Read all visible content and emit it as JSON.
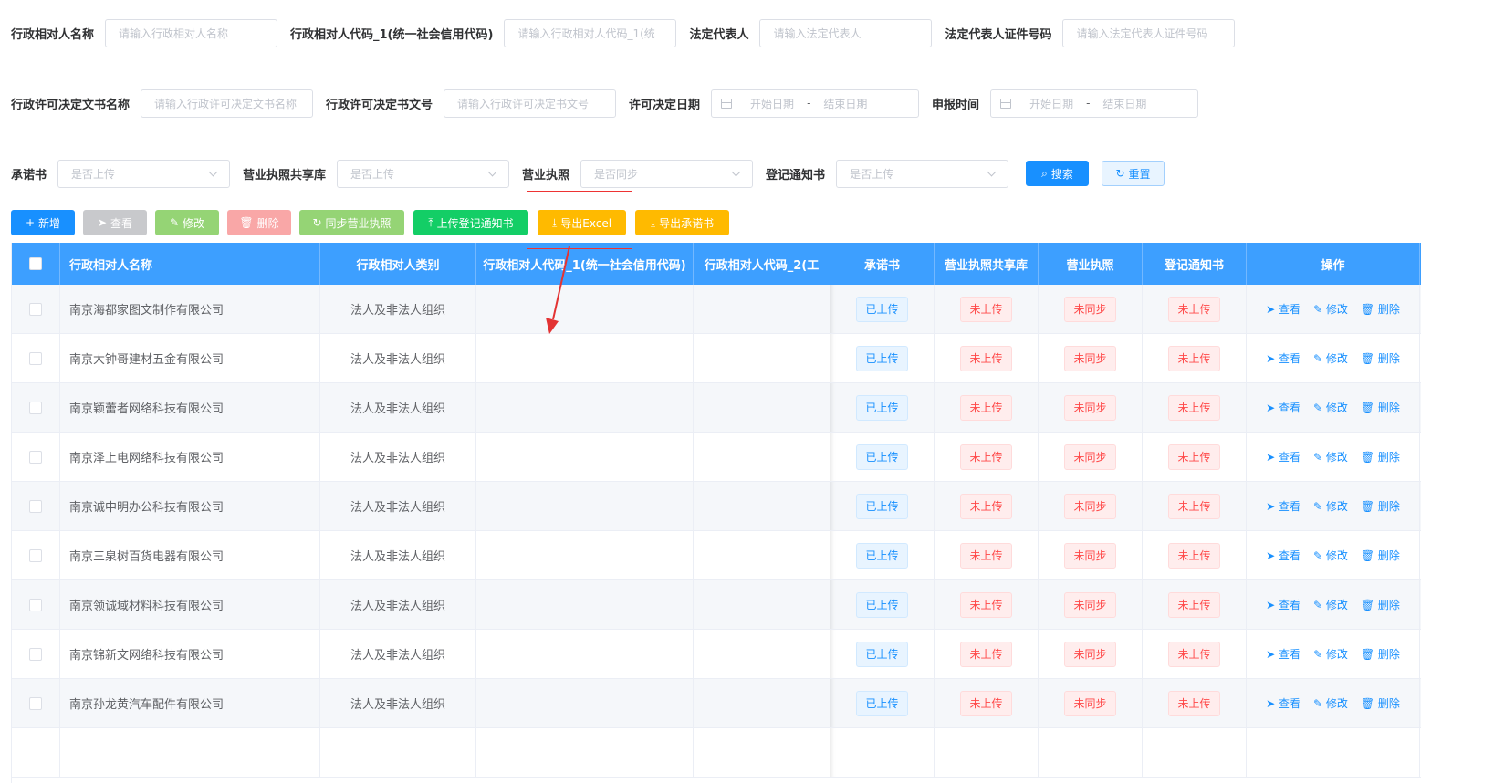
{
  "filters": {
    "row1": [
      {
        "label": "行政相对人名称",
        "placeholder": "请输入行政相对人名称"
      },
      {
        "label": "行政相对人代码_1(统一社会信用代码)",
        "placeholder": "请输入行政相对人代码_1(统"
      },
      {
        "label": "法定代表人",
        "placeholder": "请输入法定代表人"
      },
      {
        "label": "法定代表人证件号码",
        "placeholder": "请输入法定代表人证件号码"
      }
    ],
    "row2": {
      "doc_name": {
        "label": "行政许可决定文书名称",
        "placeholder": "请输入行政许可决定文书名称"
      },
      "doc_no": {
        "label": "行政许可决定书文号",
        "placeholder": "请输入行政许可决定书文号"
      },
      "decision_date": {
        "label": "许可决定日期",
        "start": "开始日期",
        "sep": "-",
        "end": "结束日期"
      },
      "report_time": {
        "label": "申报时间",
        "start": "开始日期",
        "sep": "-",
        "end": "结束日期"
      }
    },
    "row3": [
      {
        "label": "承诺书",
        "placeholder": "是否上传"
      },
      {
        "label": "营业执照共享库",
        "placeholder": "是否上传"
      },
      {
        "label": "营业执照",
        "placeholder": "是否同步"
      },
      {
        "label": "登记通知书",
        "placeholder": "是否上传"
      }
    ],
    "search_label": "搜索",
    "reset_label": "重置"
  },
  "toolbar": {
    "add": "新增",
    "view": "查看",
    "edit": "修改",
    "delete": "删除",
    "sync": "同步营业执照",
    "upload_notice": "上传登记通知书",
    "export_excel": "导出Excel",
    "export_promise": "导出承诺书"
  },
  "table": {
    "headers": [
      "行政相对人名称",
      "行政相对人类别",
      "行政相对人代码_1(统一社会信用代码)",
      "行政相对人代码_2(工",
      "承诺书",
      "营业执照共享库",
      "营业执照",
      "登记通知书",
      "操作"
    ],
    "rows": [
      {
        "name": "南京海都家图文制作有限公司",
        "type": "法人及非法人组织",
        "code1": "",
        "code2": "",
        "promise": "已上传",
        "share": "未上传",
        "license": "未同步",
        "notice": "未上传"
      },
      {
        "name": "南京大钟哥建材五金有限公司",
        "type": "法人及非法人组织",
        "code1": "",
        "code2": "",
        "promise": "已上传",
        "share": "未上传",
        "license": "未同步",
        "notice": "未上传"
      },
      {
        "name": "南京颖蕾者网络科技有限公司",
        "type": "法人及非法人组织",
        "code1": "",
        "code2": "",
        "promise": "已上传",
        "share": "未上传",
        "license": "未同步",
        "notice": "未上传"
      },
      {
        "name": "南京泽上电网络科技有限公司",
        "type": "法人及非法人组织",
        "code1": "",
        "code2": "",
        "promise": "已上传",
        "share": "未上传",
        "license": "未同步",
        "notice": "未上传"
      },
      {
        "name": "南京诚中明办公科技有限公司",
        "type": "法人及非法人组织",
        "code1": "",
        "code2": "",
        "promise": "已上传",
        "share": "未上传",
        "license": "未同步",
        "notice": "未上传"
      },
      {
        "name": "南京三泉树百货电器有限公司",
        "type": "法人及非法人组织",
        "code1": "",
        "code2": "",
        "promise": "已上传",
        "share": "未上传",
        "license": "未同步",
        "notice": "未上传"
      },
      {
        "name": "南京领诚域材料科技有限公司",
        "type": "法人及非法人组织",
        "code1": "",
        "code2": "",
        "promise": "已上传",
        "share": "未上传",
        "license": "未同步",
        "notice": "未上传"
      },
      {
        "name": "南京锦新文网络科技有限公司",
        "type": "法人及非法人组织",
        "code1": "",
        "code2": "",
        "promise": "已上传",
        "share": "未上传",
        "license": "未同步",
        "notice": "未上传"
      },
      {
        "name": "南京孙龙黄汽车配件有限公司",
        "type": "法人及非法人组织",
        "code1": "",
        "code2": "",
        "promise": "已上传",
        "share": "未上传",
        "license": "未同步",
        "notice": "未上传"
      },
      {
        "name": "",
        "type": "",
        "code1": "",
        "code2": "",
        "promise": "",
        "share": "",
        "license": "",
        "notice": ""
      }
    ],
    "row_actions": {
      "view": "查看",
      "edit": "修改",
      "delete": "删除"
    }
  },
  "colors": {
    "primary": "#1890ff",
    "header_bg": "#3d9fff",
    "success": "#13ce66",
    "warning": "#ffba00",
    "danger": "#ff4949",
    "annotation": "#e33333"
  }
}
